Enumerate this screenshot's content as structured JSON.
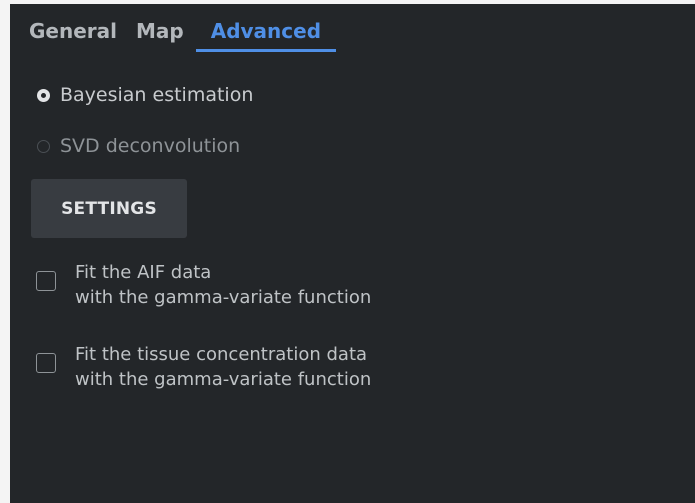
{
  "tabs": [
    {
      "label": "General",
      "active": false
    },
    {
      "label": "Map",
      "active": false
    },
    {
      "label": "Advanced",
      "active": true
    }
  ],
  "method": {
    "options": [
      {
        "label": "Bayesian estimation",
        "checked": true
      },
      {
        "label": "SVD deconvolution",
        "checked": false
      }
    ]
  },
  "settings_button": {
    "label": "SETTINGS"
  },
  "checkboxes": [
    {
      "line1": "Fit the AIF data",
      "line2": "with the gamma-variate function",
      "checked": false
    },
    {
      "line1": "Fit the tissue concentration data",
      "line2": "with the gamma-variate function",
      "checked": false
    }
  ],
  "colors": {
    "background": "#232629",
    "accent": "#4f8fe6",
    "button": "#383c41",
    "text": "#c8cbce"
  }
}
